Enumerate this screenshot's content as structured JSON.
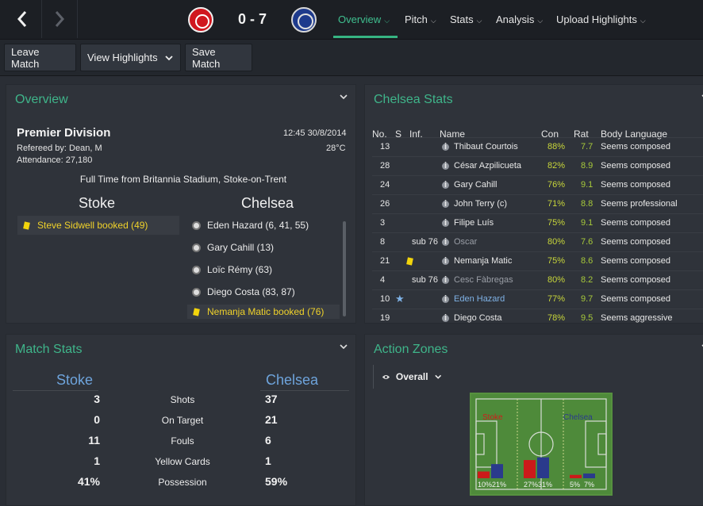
{
  "topbar": {
    "home_badge_icon": "stoke-badge-icon",
    "away_badge_icon": "chelsea-badge-icon",
    "score": "0 - 7",
    "tabs": [
      {
        "label": "Overview",
        "active": true
      },
      {
        "label": "Pitch"
      },
      {
        "label": "Stats"
      },
      {
        "label": "Analysis"
      },
      {
        "label": "Upload Highlights"
      }
    ]
  },
  "toolbar": {
    "leave_match": "Leave Match",
    "view_highlights": "View Highlights",
    "save_match": "Save Match"
  },
  "overview": {
    "title": "Overview",
    "competition": "Premier Division",
    "referee": "Refereed by: Dean, M",
    "attendance": "Attendance: 27,180",
    "datetime": "12:45 30/8/2014",
    "temperature": "28°C",
    "venue": "Full Time from Britannia Stadium, Stoke-on-Trent",
    "home_team": "Stoke",
    "away_team": "Chelsea",
    "home_events": [
      {
        "text": "Steve Sidwell booked (49)",
        "type": "booking"
      }
    ],
    "away_events": [
      {
        "text": "Eden Hazard (6, 41, 55)",
        "type": "goal"
      },
      {
        "text": "Gary Cahill (13)",
        "type": "goal"
      },
      {
        "text": "Loïc Rémy (63)",
        "type": "goal"
      },
      {
        "text": "Diego Costa (83, 87)",
        "type": "goal"
      },
      {
        "text": "Nemanja Matic booked (76)",
        "type": "booking"
      }
    ]
  },
  "chelsea_stats": {
    "title": "Chelsea Stats",
    "headers": {
      "no": "No.",
      "s": "S",
      "inf": "Inf.",
      "name": "Name",
      "con": "Con",
      "rat": "Rat",
      "body": "Body Language"
    },
    "rows": [
      {
        "no": "13",
        "s": "",
        "inf": "",
        "name": "Thibaut Courtois",
        "con": "88%",
        "rat": "7.7",
        "body": "Seems composed",
        "style": "normal"
      },
      {
        "no": "28",
        "s": "",
        "inf": "",
        "name": "César Azpilicueta",
        "con": "82%",
        "rat": "8.9",
        "body": "Seems composed",
        "style": "normal"
      },
      {
        "no": "24",
        "s": "",
        "inf": "",
        "name": "Gary Cahill",
        "con": "76%",
        "rat": "9.1",
        "body": "Seems composed",
        "style": "normal"
      },
      {
        "no": "26",
        "s": "",
        "inf": "",
        "name": "John Terry (c)",
        "con": "71%",
        "rat": "8.8",
        "body": "Seems professional",
        "style": "normal"
      },
      {
        "no": "3",
        "s": "",
        "inf": "",
        "name": "Filipe Luís",
        "con": "75%",
        "rat": "9.1",
        "body": "Seems composed",
        "style": "normal"
      },
      {
        "no": "8",
        "s": "",
        "inf": "sub 76",
        "name": "Oscar",
        "con": "80%",
        "rat": "7.6",
        "body": "Seems composed",
        "style": "dim"
      },
      {
        "no": "21",
        "s": "",
        "inf": "card",
        "name": "Nemanja Matic",
        "con": "75%",
        "rat": "8.6",
        "body": "Seems composed",
        "style": "normal"
      },
      {
        "no": "4",
        "s": "",
        "inf": "sub 76",
        "name": "Cesc Fàbregas",
        "con": "80%",
        "rat": "8.2",
        "body": "Seems composed",
        "style": "dim"
      },
      {
        "no": "10",
        "s": "star",
        "inf": "",
        "name": "Eden Hazard",
        "con": "77%",
        "rat": "9.7",
        "body": "Seems composed",
        "style": "blue"
      },
      {
        "no": "19",
        "s": "",
        "inf": "",
        "name": "Diego Costa",
        "con": "78%",
        "rat": "9.5",
        "body": "Seems aggressive",
        "style": "normal"
      }
    ]
  },
  "match_stats": {
    "title": "Match Stats",
    "home_team": "Stoke",
    "away_team": "Chelsea",
    "rows": [
      {
        "label": "Shots",
        "home": "3",
        "away": "37"
      },
      {
        "label": "On Target",
        "home": "0",
        "away": "21"
      },
      {
        "label": "Fouls",
        "home": "11",
        "away": "6"
      },
      {
        "label": "Yellow Cards",
        "home": "1",
        "away": "1"
      },
      {
        "label": "Possession",
        "home": "41%",
        "away": "59%"
      }
    ]
  },
  "action_zones": {
    "title": "Action Zones",
    "selector": "Overall",
    "home_label": "Stoke",
    "away_label": "Chelsea",
    "colors": {
      "home": "#cc1a1a",
      "away": "#2a3a8c"
    },
    "zones": [
      {
        "home": 10,
        "away": 21,
        "home_label": "10%",
        "away_label": "21%"
      },
      {
        "home": 27,
        "away": 31,
        "home_label": "27%",
        "away_label": "31%"
      },
      {
        "home": 5,
        "away": 7,
        "home_label": "5%",
        "away_label": "7%"
      }
    ]
  }
}
